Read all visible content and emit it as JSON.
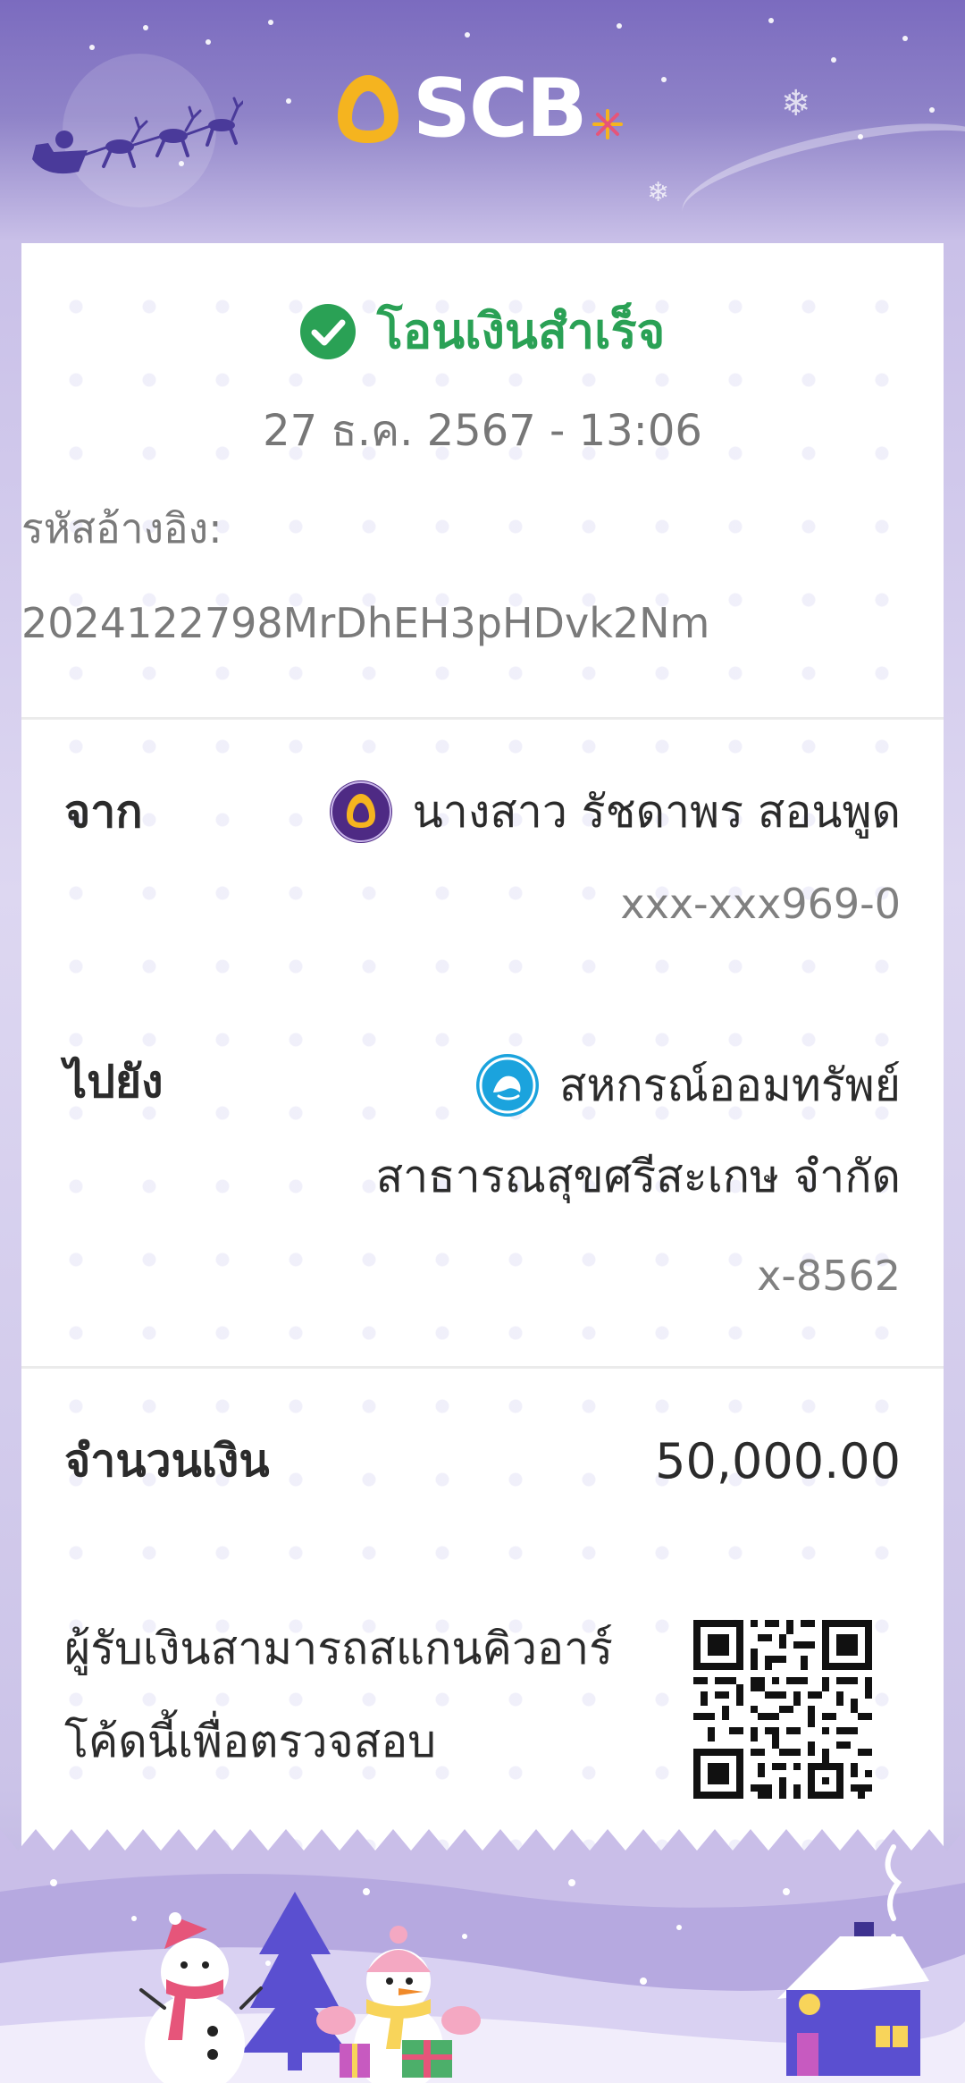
{
  "brand": {
    "name": "SCB"
  },
  "receipt": {
    "status": "โอนเงินสำเร็จ",
    "datetime": "27 ธ.ค. 2567 - 13:06",
    "reference_label": "รหัสอ้างอิง:",
    "reference_value": "2024122798MrDhEH3pHDvk2Nm",
    "from": {
      "label": "จาก",
      "name": "นางสาว รัชดาพร สอนพูด",
      "account": "xxx-xxx969-0",
      "bank_icon": "scb-bank-icon"
    },
    "to": {
      "label": "ไปยัง",
      "name_line1": "สหกรณ์ออมทรัพย์",
      "name_line2": "สาธารณสุขศรีสะเกษ จำกัด",
      "account": "x-8562",
      "bank_icon": "ktb-bank-icon"
    },
    "amount": {
      "label": "จำนวนเงิน",
      "value": "50,000.00"
    },
    "qr_note": "ผู้รับเงินสามารถสแกนคิวอาร์โค้ดนี้เพื่อตรวจสอบ",
    "qr_icon": "qr-code-icon"
  },
  "colors": {
    "success": "#2aa155",
    "header": "#7b6bbf",
    "scb_purple": "#4e2a84",
    "scb_gold": "#f5b41f",
    "ktb_blue": "#1ba3dd"
  }
}
